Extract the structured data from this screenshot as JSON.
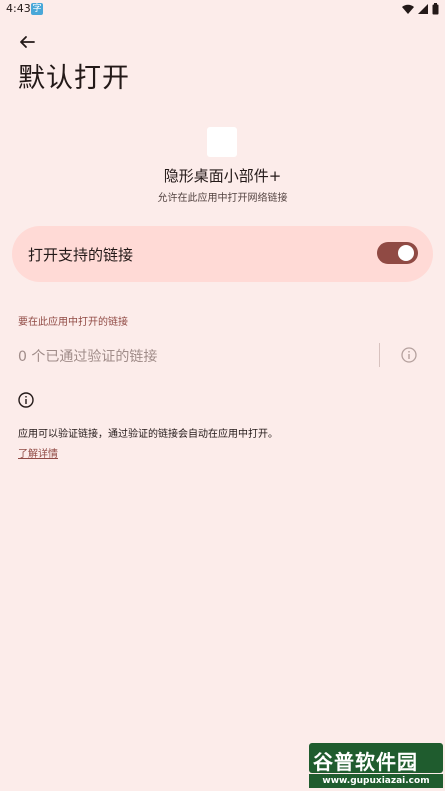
{
  "status_bar": {
    "time": "4:43",
    "app_icon_glyph": "字"
  },
  "header": {
    "title": "默认打开"
  },
  "app": {
    "name": "隐形桌面小部件+",
    "subtitle": "允许在此应用中打开网络链接"
  },
  "toggle": {
    "label": "打开支持的链接",
    "enabled": true
  },
  "section": {
    "header": "要在此应用中打开的链接",
    "verified_text": "0 个已通过验证的链接"
  },
  "footer": {
    "text": "应用可以验证链接，通过验证的链接会自动在应用中打开。",
    "learn_more": "了解详情"
  },
  "watermark": {
    "logo": "谷普软件园",
    "url": "www.gupuxiazai.com"
  },
  "colors": {
    "background": "#fcecea",
    "card": "#ffdad6",
    "accent": "#904a44"
  },
  "icons": {
    "back": "arrow-left-icon",
    "info": "info-circle-icon",
    "wifi": "wifi-icon",
    "signal": "signal-icon",
    "battery": "battery-icon"
  }
}
